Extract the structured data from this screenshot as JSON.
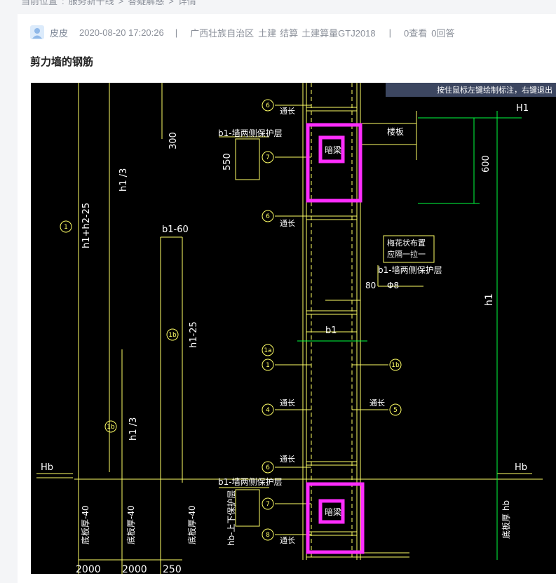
{
  "breadcrumb": {
    "items": [
      "当前位置",
      "服务新干线",
      "答疑解惑",
      "详情"
    ],
    "separators": [
      ":",
      ">",
      ">"
    ]
  },
  "post": {
    "author": "皮皮",
    "datetime": "2020-08-20 17:20:26",
    "divider": "|",
    "region": "广西壮族自治区",
    "tags": [
      "土建",
      "结算",
      "土建算量GTJ2018"
    ],
    "views": "0查看",
    "answers": "0回答",
    "title": "剪力墙的钢筋"
  },
  "drawing": {
    "tooltip": "按住鼠标左键绘制标注，右键退出",
    "labels": {
      "H1": "H1",
      "Hb_left": "Hb",
      "Hb_right": "Hb",
      "h1": "h1",
      "h1_3_top": "h1 /3",
      "h1_3_bottom": "h1 /3",
      "h1_25": "h1-25",
      "h1_h2_25": "h1+h2-25",
      "b1_60": "b1-60",
      "b1": "b1",
      "d300": "300",
      "d550": "550",
      "d600": "600",
      "d80": "80",
      "phi8": "Φ8",
      "cover1": "b1-墙两侧保护层",
      "cover2": "b1-墙两侧保护层",
      "cover3": "b1-墙两侧保护层",
      "hb_cover": "hb-上下保护层",
      "slab": "楼板",
      "dark_beam_top": "暗梁",
      "dark_beam_bottom": "暗梁",
      "plum_note_1": "梅花状布置",
      "plum_note_2": "应隔一拉一",
      "tong1": "通长",
      "tong2": "通长",
      "tong3": "通长",
      "tong4": "通长",
      "tong5": "通长",
      "tong6": "通长",
      "bot1": "底板厚-40",
      "bot2": "底板厚-40",
      "bot3": "底板厚-40",
      "bot_hb": "底板厚 hb",
      "w2000a": "2000",
      "w2000b": "2000",
      "w250": "250",
      "c1": "1",
      "c1b": "1",
      "c1a": "1a",
      "c1b_mid": "1b",
      "c1b_right": "1b",
      "c1b_low": "1b",
      "c1b_left": "1b",
      "c4": "4",
      "c5": "5",
      "c6a": "6",
      "c6b": "6",
      "c6c": "6",
      "c7a": "7",
      "c7b": "7",
      "c8": "8"
    },
    "colors": {
      "background": "#000000",
      "yellow": "#ffff66",
      "white": "#ffffff",
      "green": "#00ff40",
      "magenta": "#ff2dff",
      "tooltip_bg": "#3c4660"
    }
  }
}
